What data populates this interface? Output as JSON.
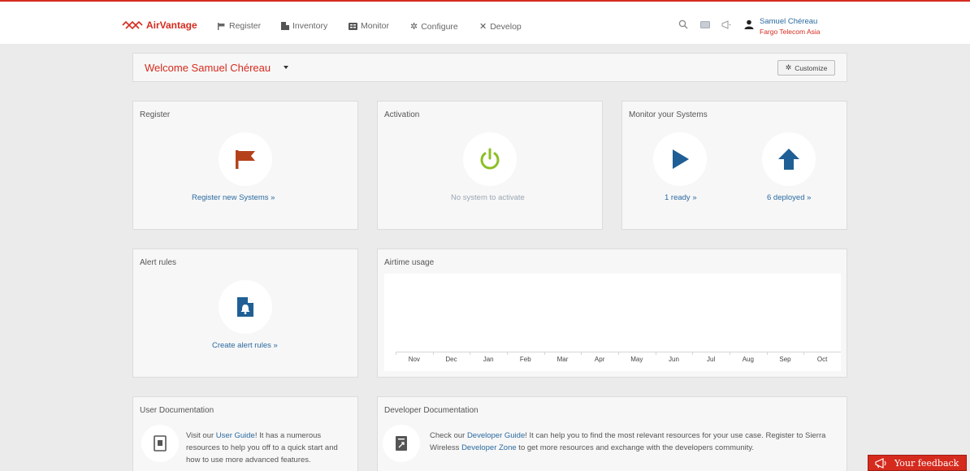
{
  "brand": {
    "name": "AirVantage",
    "color": "#d52b1e"
  },
  "nav": {
    "items": [
      {
        "label": "Register",
        "icon": "flag-icon"
      },
      {
        "label": "Inventory",
        "icon": "inventory-icon"
      },
      {
        "label": "Monitor",
        "icon": "monitor-icon"
      },
      {
        "label": "Configure",
        "icon": "gear-icon"
      },
      {
        "label": "Develop",
        "icon": "tools-icon"
      }
    ],
    "right_icons": [
      "search-icon",
      "message-icon",
      "megaphone-icon"
    ]
  },
  "user": {
    "name": "Samuel Chéreau",
    "organization": "Fargo Telecom Asia"
  },
  "welcome": {
    "text": "Welcome Samuel Chéreau",
    "customize_label": "Customize"
  },
  "panels": {
    "register": {
      "title": "Register",
      "link": "Register new Systems »"
    },
    "activation": {
      "title": "Activation",
      "status": "No system to activate"
    },
    "monitor": {
      "title": "Monitor your Systems",
      "ready_link": "1 ready »",
      "deployed_link": "6 deployed »"
    },
    "alerts": {
      "title": "Alert rules",
      "link": "Create alert rules »"
    },
    "airtime": {
      "title": "Airtime usage"
    },
    "user_doc": {
      "title": "User Documentation",
      "before": "Visit our ",
      "link": "User Guide",
      "after": "! It has a numerous resources to help you off to a quick start and how to use more advanced features."
    },
    "dev_doc": {
      "title": "Developer Documentation",
      "before": "Check our ",
      "link1": "Developer Guide",
      "middle": "! It can help you to find the most relevant resources for your use case. Register to Sierra Wireless ",
      "link2": "Developer Zone",
      "after": " to get more resources and exchange with the developers community."
    }
  },
  "chart_data": {
    "type": "bar",
    "categories": [
      "Nov",
      "Dec",
      "Jan",
      "Feb",
      "Mar",
      "Apr",
      "May",
      "Jun",
      "Jul",
      "Aug",
      "Sep",
      "Oct"
    ],
    "values": [],
    "title": "Airtime usage"
  },
  "feedback": {
    "label": "Your feedback"
  },
  "colors": {
    "accent": "#d52b1e",
    "link": "#2a6aa0",
    "monitor_icon": "#1f5f95",
    "activation_icon": "#8cbf26",
    "register_icon": "#b5411b"
  }
}
